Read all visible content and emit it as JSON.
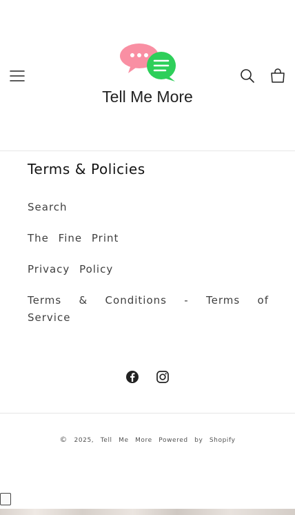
{
  "header": {
    "logo_text": "Tell Me More",
    "colors": {
      "bubble_pink": "#f98fa3",
      "bubble_green": "#2ecf5a",
      "text": "#222222"
    }
  },
  "footer": {
    "heading": "Terms & Policies",
    "links": [
      {
        "label": "Search"
      },
      {
        "label": "The Fine Print"
      },
      {
        "label": "Privacy Policy"
      },
      {
        "label": "Terms & Conditions - Terms of Service"
      }
    ],
    "socials": [
      {
        "name": "facebook-icon",
        "label": "Facebook"
      },
      {
        "name": "instagram-icon",
        "label": "Instagram"
      }
    ],
    "copyright": {
      "symbol": "©",
      "year": "2025,",
      "store": "Tell Me More",
      "powered": "Powered by Shopify"
    }
  }
}
